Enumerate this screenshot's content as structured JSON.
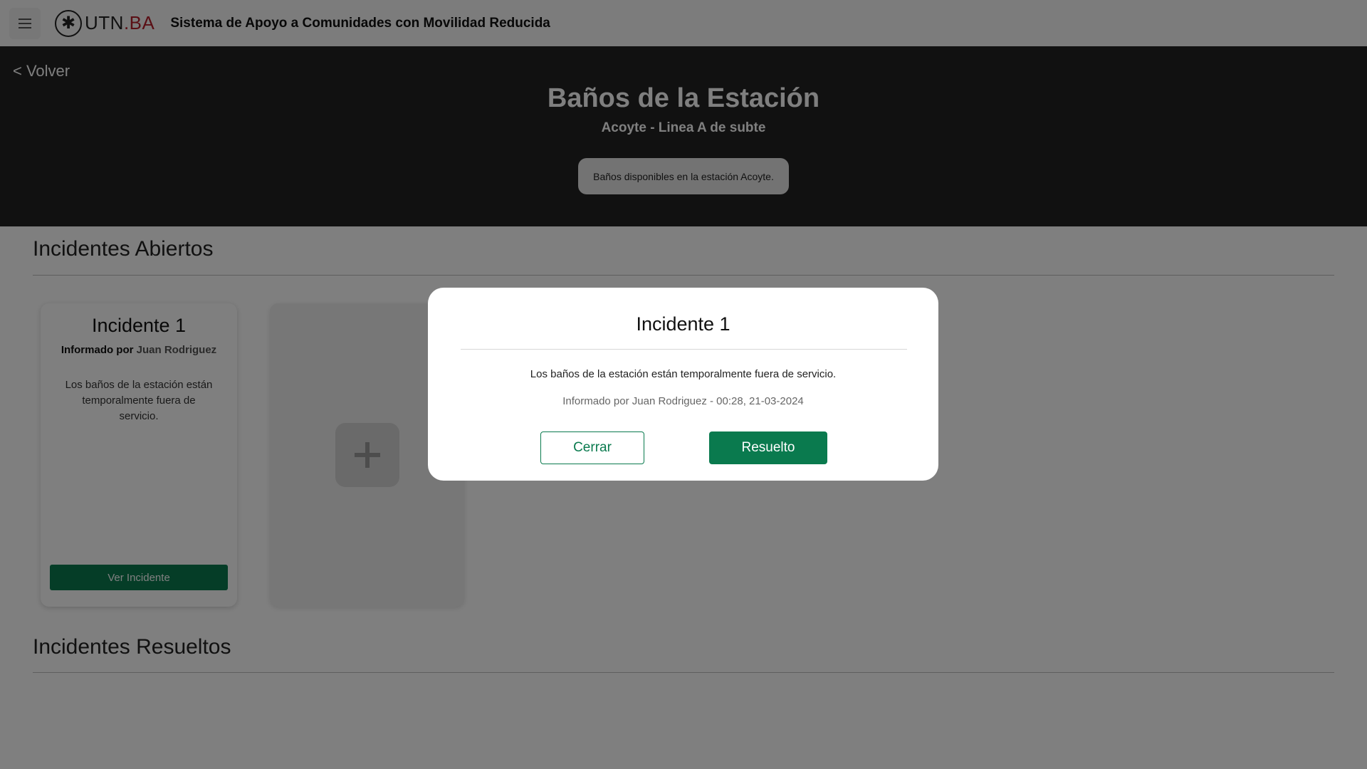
{
  "header": {
    "logo_text": "UTN",
    "logo_suffix": ".BA",
    "app_title": "Sistema de Apoyo a Comunidades con Movilidad Reducida",
    "menu_icon": "hamburger-menu-icon"
  },
  "hero": {
    "back_label": "< Volver",
    "title": "Baños de la Estación",
    "subtitle": "Acoyte - Linea A de subte",
    "description": "Baños disponibles en la estación Acoyte."
  },
  "sections": {
    "open_title": "Incidentes Abiertos",
    "resolved_title": "Incidentes Resueltos"
  },
  "incident_card": {
    "title": "Incidente 1",
    "reporter_prefix": "Informado por",
    "reporter_name": "Juan Rodriguez",
    "description": "Los baños de la estación están temporalmente fuera de servicio.",
    "button_label": "Ver Incidente"
  },
  "add_card": {
    "icon": "plus-icon"
  },
  "modal": {
    "title": "Incidente 1",
    "description": "Los baños de la estación están temporalmente fuera de servicio.",
    "meta": "Informado por Juan Rodriguez - 00:28, 21-03-2024",
    "close_label": "Cerrar",
    "resolve_label": "Resuelto"
  },
  "colors": {
    "accent_green": "#0a7a4e",
    "hero_background": "#222222",
    "logo_red": "#b41e2a"
  }
}
